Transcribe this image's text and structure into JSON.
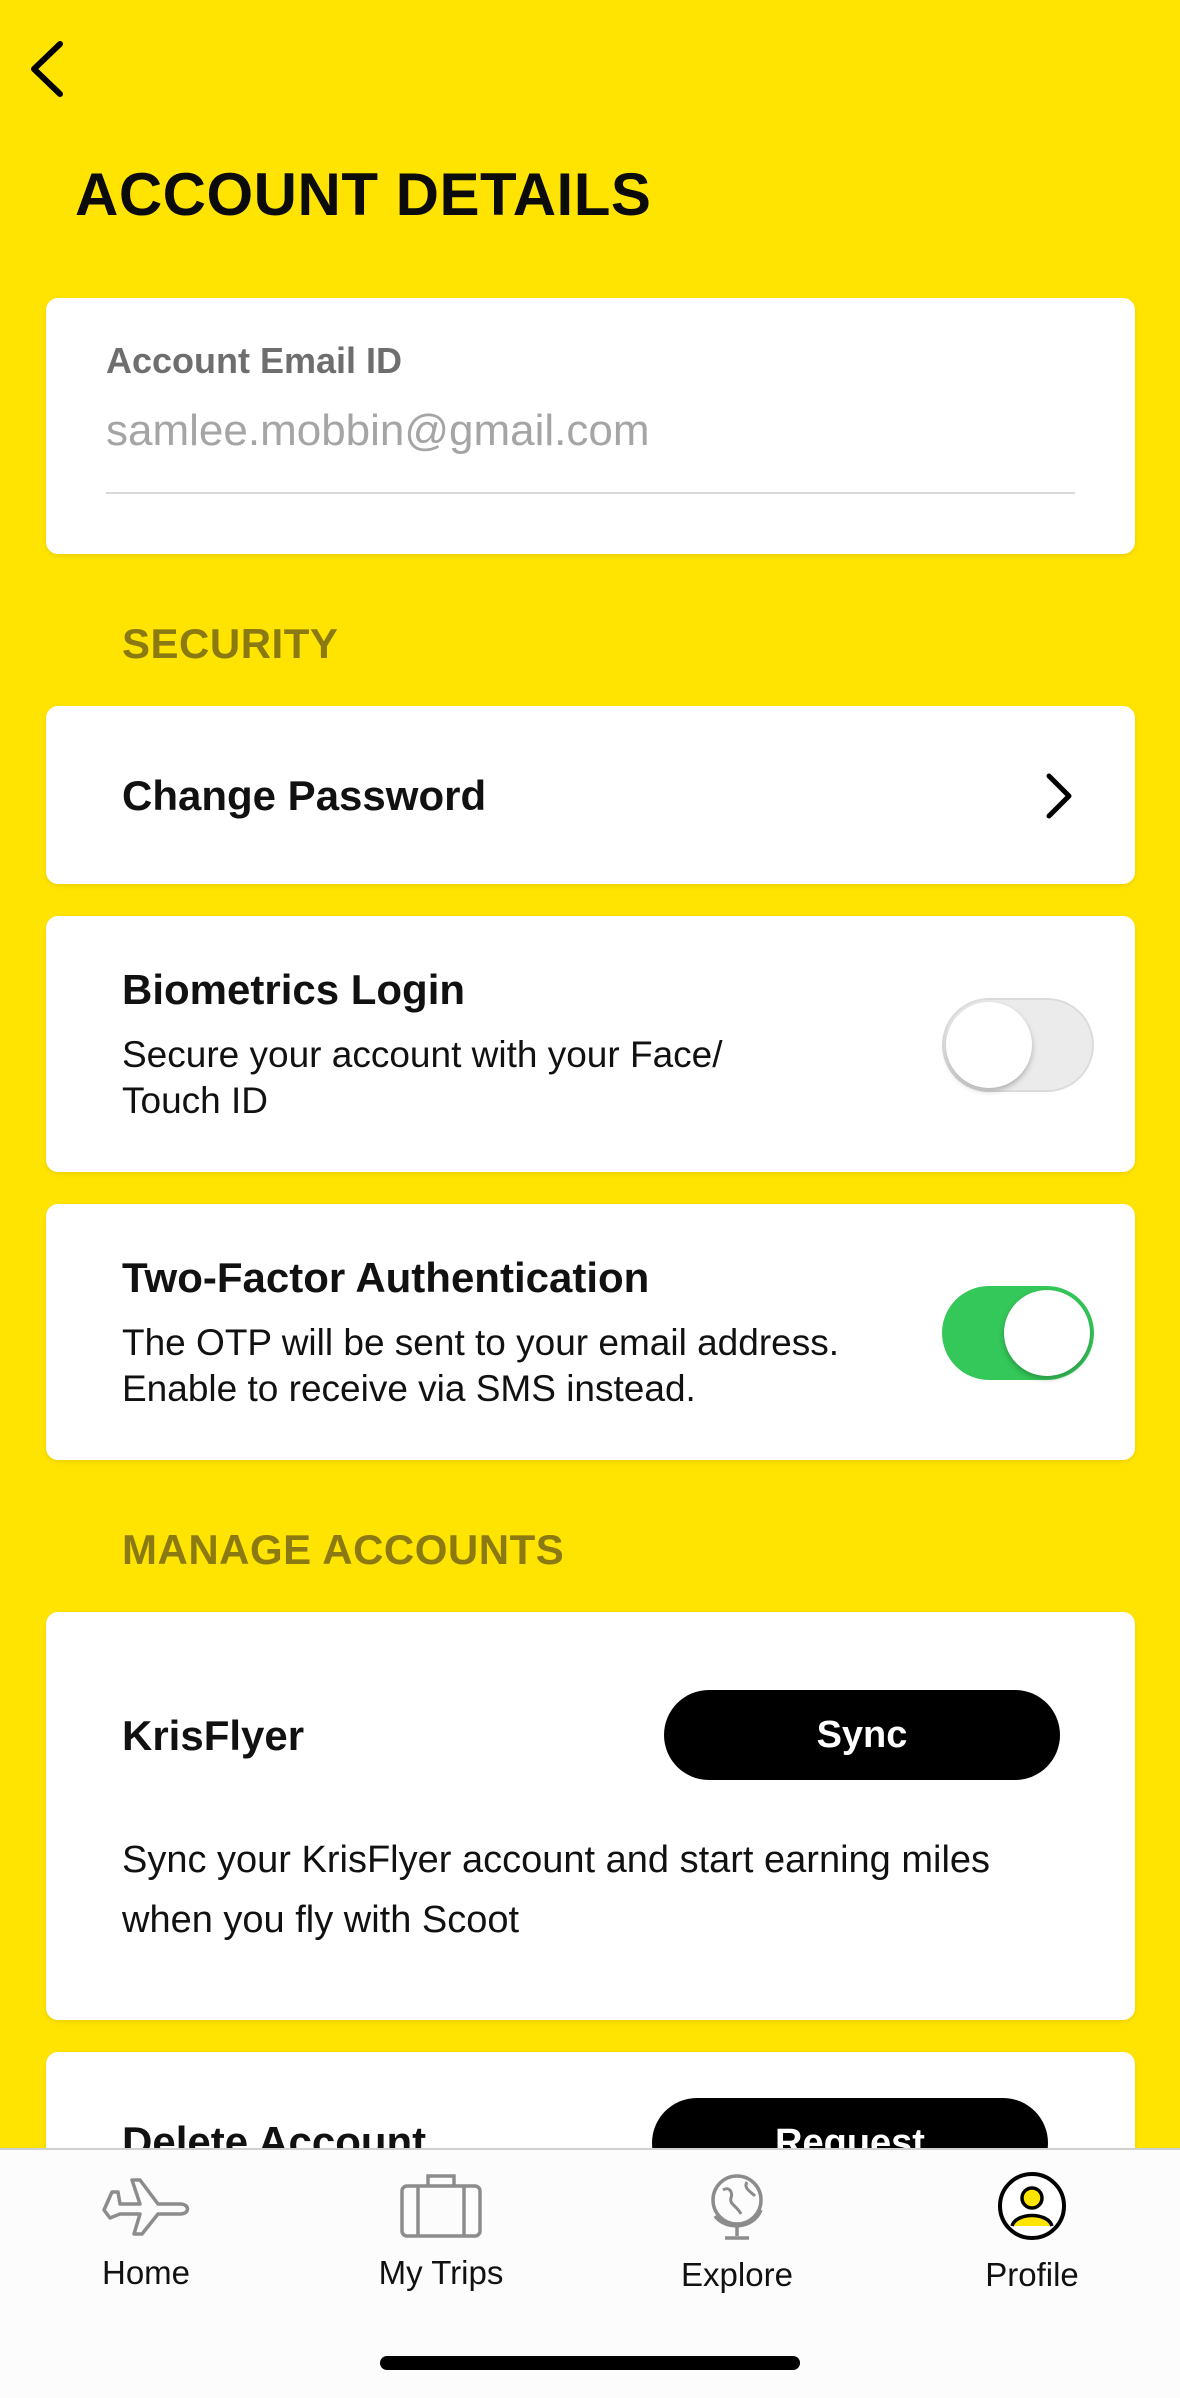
{
  "header": {
    "title": "ACCOUNT DETAILS"
  },
  "email": {
    "label": "Account Email ID",
    "value": "samlee.mobbin@gmail.com"
  },
  "security": {
    "section_label": "SECURITY",
    "change_password": {
      "label": "Change Password"
    },
    "biometrics": {
      "title": "Biometrics Login",
      "desc_line1": "Secure your account with your Face/",
      "desc_line2": "Touch ID",
      "enabled": false
    },
    "two_factor": {
      "title": "Two-Factor Authentication",
      "desc_line1": "The OTP will be sent to your email address.",
      "desc_line2": "Enable to receive via SMS instead.",
      "enabled": true
    }
  },
  "manage_accounts": {
    "section_label": "MANAGE ACCOUNTS",
    "krisflyer": {
      "title": "KrisFlyer",
      "button_label": "Sync",
      "desc_line1": "Sync your KrisFlyer account and start earning miles",
      "desc_line2": "when you fly with Scoot"
    },
    "delete_account": {
      "title": "Delete Account",
      "button_label": "Request"
    }
  },
  "tabbar": {
    "items": [
      {
        "label": "Home",
        "icon": "airplane-icon",
        "active": false
      },
      {
        "label": "My Trips",
        "icon": "suitcase-icon",
        "active": false
      },
      {
        "label": "Explore",
        "icon": "globe-icon",
        "active": false
      },
      {
        "label": "Profile",
        "icon": "profile-icon",
        "active": true
      }
    ]
  },
  "colors": {
    "background": "#FFE301",
    "section_label": "#8B7A12",
    "toggle_on": "#34C759",
    "button": "#000000",
    "profile_accent": "#FFE301"
  }
}
